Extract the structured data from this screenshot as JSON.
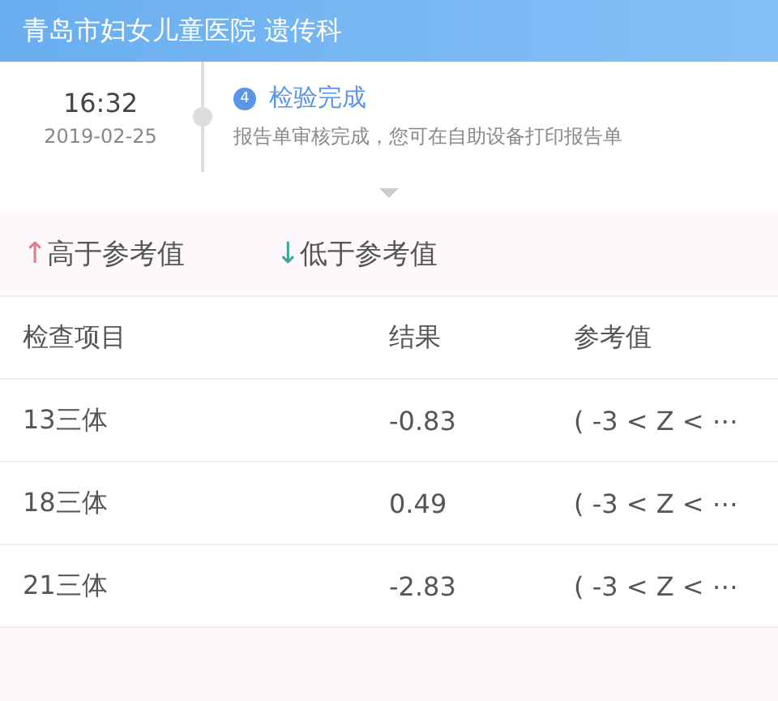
{
  "header": {
    "title": "青岛市妇女儿童医院 遗传科"
  },
  "timeline": {
    "time": "16:32",
    "date": "2019-02-25",
    "step": "4",
    "status": "检验完成",
    "description": "报告单审核完成，您可在自助设备打印报告单"
  },
  "legend": [
    {
      "arrow": "↑",
      "label": "高于参考值",
      "color": "#e07a8a"
    },
    {
      "arrow": "↓",
      "label": "低于参考值",
      "color": "#3aa69a"
    }
  ],
  "table": {
    "columns": [
      "检查项目",
      "结果",
      "参考值"
    ],
    "rows": [
      [
        "13三体",
        "-0.83",
        "( -3 < Z < ⋯"
      ],
      [
        "18三体",
        "0.49",
        "( -3 < Z < ⋯"
      ],
      [
        "21三体",
        "-2.83",
        "( -3 < Z < ⋯"
      ]
    ]
  }
}
